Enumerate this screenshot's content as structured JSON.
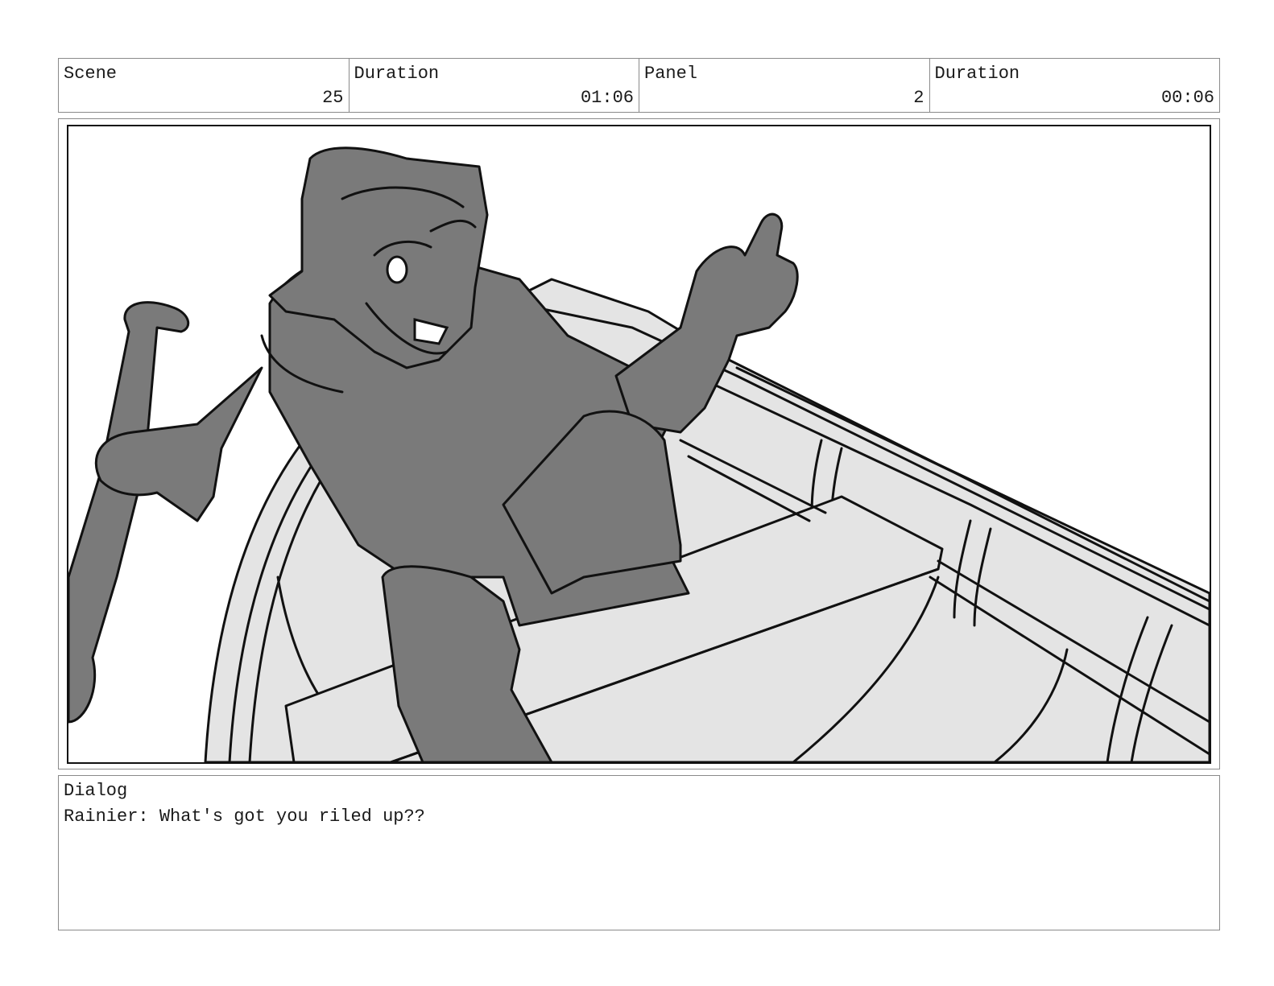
{
  "header": {
    "scene_label": "Scene",
    "scene_value": "25",
    "scene_duration_label": "Duration",
    "scene_duration_value": "01:06",
    "panel_label": "Panel",
    "panel_value": "2",
    "panel_duration_label": "Duration",
    "panel_duration_value": "00:06"
  },
  "dialog": {
    "label": "Dialog",
    "text": "Rainier: What's got you riled up??"
  },
  "colors": {
    "figure_fill": "#7a7a7a",
    "boat_fill": "#e4e4e4",
    "line": "#111111",
    "border": "#8a8a8a"
  }
}
